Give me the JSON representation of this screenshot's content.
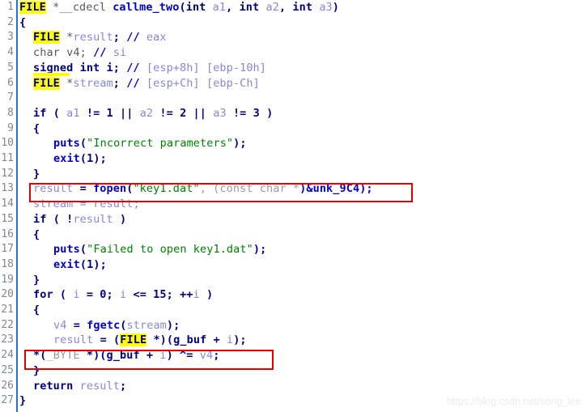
{
  "app": {
    "view_name": "hex-rays-pseudocode",
    "background_color": "#ffffff",
    "gutter_separator_color": "#2a6ed4",
    "highlight_color": "#ffff00",
    "annotation_color": "#e30000",
    "watermark": "https://blog.csdn.net/song_lee"
  },
  "line_numbers": [
    "1",
    "2",
    "3",
    "4",
    "5",
    "6",
    "7",
    "8",
    "9",
    "10",
    "11",
    "12",
    "13",
    "14",
    "15",
    "16",
    "17",
    "18",
    "19",
    "20",
    "21",
    "22",
    "23",
    "24",
    "25",
    "26",
    "27"
  ],
  "code": {
    "lines": [
      {
        "n": "1",
        "text": "FILE *__cdecl callme_two(int a1, int a2, int a3)"
      },
      {
        "n": "2",
        "text": "{"
      },
      {
        "n": "3",
        "text": "  FILE *result; // eax"
      },
      {
        "n": "4",
        "text": "  char v4; // si"
      },
      {
        "n": "5",
        "text": "  signed int i; // [esp+8h] [ebp-10h]"
      },
      {
        "n": "6",
        "text": "  FILE *stream; // [esp+Ch] [ebp-Ch]"
      },
      {
        "n": "7",
        "text": ""
      },
      {
        "n": "8",
        "text": "  if ( a1 != 1 || a2 != 2 || a3 != 3 )"
      },
      {
        "n": "9",
        "text": "  {"
      },
      {
        "n": "10",
        "text": "    puts(\"Incorrect parameters\");"
      },
      {
        "n": "11",
        "text": "    exit(1);"
      },
      {
        "n": "12",
        "text": "  }"
      },
      {
        "n": "13",
        "text": "  result = fopen(\"key1.dat\", (const char *)&unk_9C4);"
      },
      {
        "n": "14",
        "text": "  stream = result;"
      },
      {
        "n": "15",
        "text": "  if ( !result )"
      },
      {
        "n": "16",
        "text": "  {"
      },
      {
        "n": "17",
        "text": "    puts(\"Failed to open key1.dat\");"
      },
      {
        "n": "18",
        "text": "    exit(1);"
      },
      {
        "n": "19",
        "text": "  }"
      },
      {
        "n": "20",
        "text": "  for ( i = 0; i <= 15; ++i )"
      },
      {
        "n": "21",
        "text": "  {"
      },
      {
        "n": "22",
        "text": "    v4 = fgetc(stream);"
      },
      {
        "n": "23",
        "text": "    result = (FILE *)(g_buf + i);"
      },
      {
        "n": "24",
        "text": "    *(_BYTE *)(g_buf + i) ^= v4;"
      },
      {
        "n": "25",
        "text": "  }"
      },
      {
        "n": "26",
        "text": "  return result;"
      },
      {
        "n": "27",
        "text": "}"
      }
    ]
  },
  "tokens": {
    "l1": {
      "a": "FILE",
      "b": " *__cdecl ",
      "c": "callme_two",
      "d": "(",
      "e": "int",
      "f": " a1",
      "g": ", ",
      "h": "int",
      "i": " a2",
      "j": ", ",
      "k": "int",
      "l": " a3",
      "m": ")"
    },
    "l2": {
      "a": "{"
    },
    "l3": {
      "a": "FILE",
      "b": " *",
      "c": "result",
      "d": "; ",
      "e": "//",
      "f": " eax"
    },
    "l4": {
      "a": "char",
      "b": " v4; ",
      "c": "//",
      "d": " si"
    },
    "l5": {
      "a": "signed int",
      "b": " i; ",
      "c": "//",
      "d": " [esp+8h] [ebp-10h]"
    },
    "l6": {
      "a": "FILE",
      "b": " *",
      "c": "stream",
      "d": "; ",
      "e": "//",
      "f": " [esp+Ch] [ebp-Ch]"
    },
    "l8": {
      "a": "if",
      "b": " ( ",
      "c": "a1",
      "d": " != ",
      "e": "1",
      "f": " || ",
      "g": "a2",
      "h": " != ",
      "i": "2",
      "j": " || ",
      "k": "a3",
      "l": " != ",
      "m": "3",
      "n": " )"
    },
    "l9": {
      "a": "{"
    },
    "l10": {
      "a": "puts",
      "b": "(",
      "c": "\"Incorrect parameters\"",
      "d": ");"
    },
    "l11": {
      "a": "exit",
      "b": "(",
      "c": "1",
      "d": ");"
    },
    "l12": {
      "a": "}"
    },
    "l13": {
      "a": "result",
      "b": " = ",
      "c": "fopen",
      "d": "(",
      "e": "\"key1.dat\"",
      "f": ", (",
      "g": "const char *",
      "h": ")",
      "i": "&unk_9C4",
      "j": ");"
    },
    "l14": {
      "a": "stream",
      "b": " = ",
      "c": "result",
      "d": ";"
    },
    "l15": {
      "a": "if",
      "b": " ( !",
      "c": "result",
      "d": " )"
    },
    "l16": {
      "a": "{"
    },
    "l17": {
      "a": "puts",
      "b": "(",
      "c": "\"Failed to open key1.dat\"",
      "d": ");"
    },
    "l18": {
      "a": "exit",
      "b": "(",
      "c": "1",
      "d": ");"
    },
    "l19": {
      "a": "}"
    },
    "l20": {
      "a": "for",
      "b": " ( ",
      "c": "i",
      "d": " = ",
      "e": "0",
      "f": "; ",
      "g": "i",
      "h": " <= ",
      "i": "15",
      "j": "; ++",
      "k": "i",
      "l": " )"
    },
    "l21": {
      "a": "{"
    },
    "l22": {
      "a": "v4",
      "b": " = ",
      "c": "fgetc",
      "d": "(",
      "e": "stream",
      "f": ");"
    },
    "l23": {
      "a": "result",
      "b": " = (",
      "c": "FILE",
      "d": " *)(",
      "e": "g_buf",
      "f": " + ",
      "g": "i",
      "h": ");"
    },
    "l24": {
      "a": "*(",
      "b": "_BYTE",
      "c": " *)(",
      "d": "g_buf",
      "e": " + ",
      "f": "i",
      "g": ") ^= ",
      "h": "v4",
      "i": ";"
    },
    "l25": {
      "a": "}"
    },
    "l26": {
      "a": "return",
      "b": " ",
      "c": "result",
      "d": ";"
    },
    "l27": {
      "a": "}"
    }
  },
  "annotations": {
    "boxes": [
      {
        "name": "fopen-call-highlight",
        "target_line": "13"
      },
      {
        "name": "xor-decrypt-highlight",
        "target_line": "24"
      }
    ]
  },
  "highlights": {
    "identifier": "FILE",
    "occurrences": [
      "line 1",
      "line 3",
      "line 6",
      "line 23"
    ]
  }
}
